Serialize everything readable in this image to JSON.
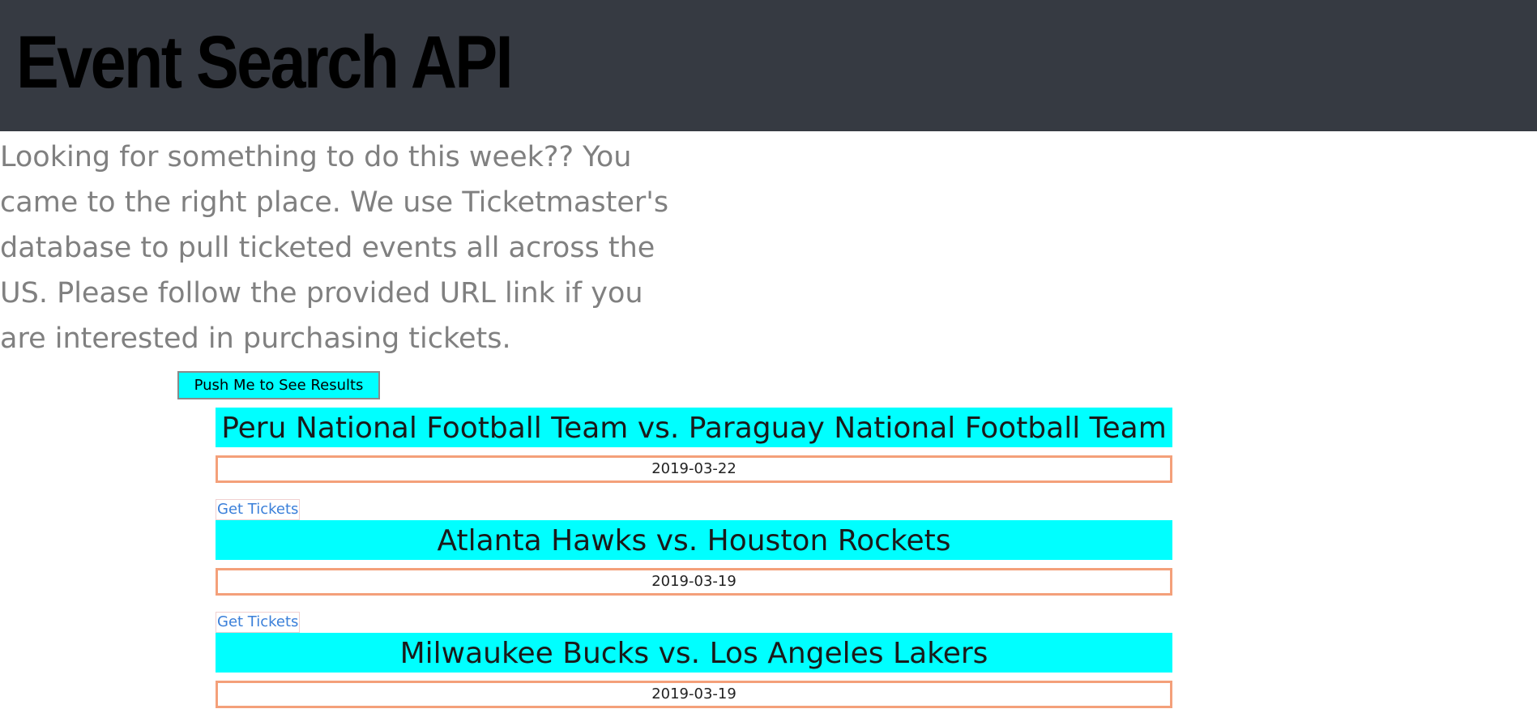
{
  "header": {
    "title": "Event Search API"
  },
  "intro": {
    "text": "Looking for something to do this week?? You came to the right place. We use Ticketmaster's database to pull ticketed events all across the US. Please follow the provided URL link if you are interested in purchasing tickets."
  },
  "search_button": {
    "label": "Push Me to See Results"
  },
  "events": [
    {
      "name": "Peru National Football Team vs. Paraguay National Football Team",
      "date": "2019-03-22",
      "link_label": "Get Tickets"
    },
    {
      "name": "Atlanta Hawks vs. Houston Rockets",
      "date": "2019-03-19",
      "link_label": "Get Tickets"
    },
    {
      "name": "Milwaukee Bucks vs. Los Angeles Lakers",
      "date": "2019-03-19"
    }
  ],
  "colors": {
    "header_bg": "#363a42",
    "accent": "#00ffff",
    "date_border": "#f4a07a",
    "link": "#3a7fd9",
    "intro_text": "#808080"
  }
}
